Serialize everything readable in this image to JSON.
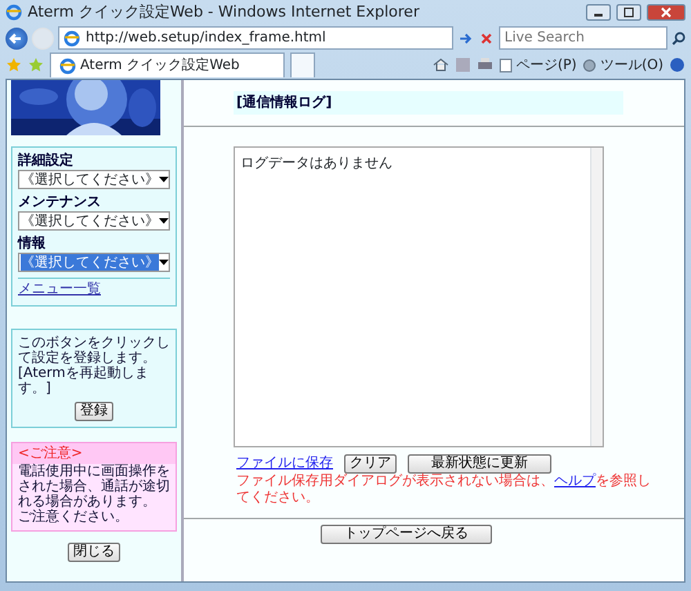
{
  "window": {
    "title": "Aterm クイック設定Web - Windows Internet Explorer"
  },
  "address_bar": {
    "url": "http://web.setup/index_frame.html"
  },
  "search": {
    "placeholder": "Live Search"
  },
  "tab": {
    "label": "Aterm クイック設定Web",
    "selected": true
  },
  "toolbar": {
    "page_menu": "ページ(P)",
    "tools_menu": "ツール(O)"
  },
  "sidebar": {
    "logo": {
      "kind": "picture"
    },
    "menus": [
      {
        "label": "詳細設定",
        "value": "《選択してください》",
        "focused": false
      },
      {
        "label": "メンテナンス",
        "value": "《選択してください》",
        "focused": false
      },
      {
        "label": "情報",
        "value": "《選択してください》",
        "focused": true
      }
    ],
    "menu_list_link": "メニュー一覧",
    "register_note": "このボタンをクリックして設定を登録します。[Atermを再起動します。]",
    "register_button": "登録",
    "caution_title": "<ご注意>",
    "caution_text": [
      "電話使用中に画面操作をされた場合、通話が途切れる場合があります。",
      "ご注意ください。"
    ],
    "close_button": "閉じる"
  },
  "main": {
    "heading": "[通信情報ログ]",
    "log_text": "ログデータはありません",
    "save_link": "ファイルに保存",
    "clear_button": "クリア",
    "refresh_button": "最新状態に更新",
    "notice": {
      "before": "ファイル保存用ダイアログが表示されない場合は、",
      "link": "ヘルプ",
      "after": "を参照してください。"
    },
    "back_button": "トップページへ戻る"
  }
}
